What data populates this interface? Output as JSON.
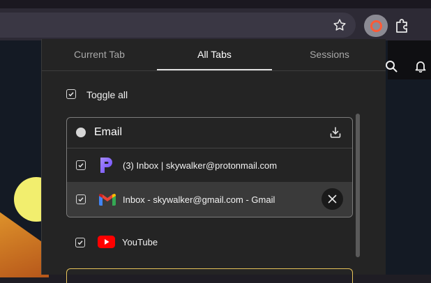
{
  "browser": {
    "star_icon": "star-icon",
    "extension_icon": "extension-ring-icon",
    "puzzle_icon": "puzzle-icon",
    "accent_color": "#ff5a36"
  },
  "popup": {
    "tabs": [
      {
        "label": "Current Tab",
        "active": false
      },
      {
        "label": "All Tabs",
        "active": true
      },
      {
        "label": "Sessions",
        "active": false
      }
    ],
    "toggle_all_label": "Toggle all",
    "group": {
      "title": "Email",
      "items": [
        {
          "title": "(3) Inbox | skywalker@protonmail.com",
          "icon": "proton-mail-icon",
          "checked": true
        },
        {
          "title": "Inbox - skywalker@gmail.com - Gmail",
          "icon": "gmail-icon",
          "checked": true
        }
      ]
    },
    "ungrouped": [
      {
        "title": "YouTube",
        "icon": "youtube-icon",
        "checked": true
      }
    ]
  }
}
